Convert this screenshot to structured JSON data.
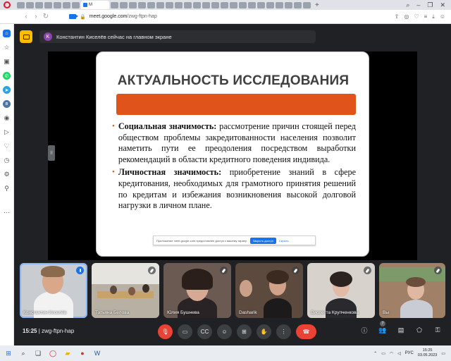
{
  "browser": {
    "active_tab_label": "M",
    "url_host": "meet.google.com",
    "url_path": "/zwg-ftpn-hap"
  },
  "banner": {
    "avatar_letter": "K",
    "text": "Константин Киселёв сейчас на главном экране"
  },
  "slide": {
    "title": "АКТУАЛЬНОСТЬ ИССЛЕДОВАНИЯ",
    "bullets": [
      {
        "term": "Социальная значимость:",
        "text": " рассмотрение причин стоящей перед обществом проблемы закредитованности населения позволит наметить пути ее преодоления посредством выработки рекомендаций в области кредитного поведения индивида."
      },
      {
        "term": "Личностная значимость:",
        "text": " приобретение знаний в сфере кредитования, необходимых для грамотного принятия решений по кредитам и избежания возникновения высокой долговой нагрузки в личном плане."
      }
    ],
    "share_notice": {
      "text": "Приложение meet.google.com предоставлен доступ к вашему экрану.",
      "stop_label": "Закрыть доступ",
      "hide_label": "Скрыть"
    }
  },
  "participants": [
    {
      "name": "Константин Киселёв",
      "speaking": true
    },
    {
      "name": "Татьяна Белова",
      "speaking": false
    },
    {
      "name": "Юлия Бушнева",
      "speaking": false
    },
    {
      "name": "Dasharik",
      "speaking": false
    },
    {
      "name": "Виолетта Крупченкова",
      "speaking": false
    },
    {
      "name": "Вы",
      "speaking": false
    }
  ],
  "controls": {
    "time": "15:25",
    "meeting_code": "zwg-ftpn-hap",
    "people_count": "7"
  },
  "taskbar": {
    "language": "РУС",
    "time": "15:25",
    "date": "03.05.2023"
  }
}
